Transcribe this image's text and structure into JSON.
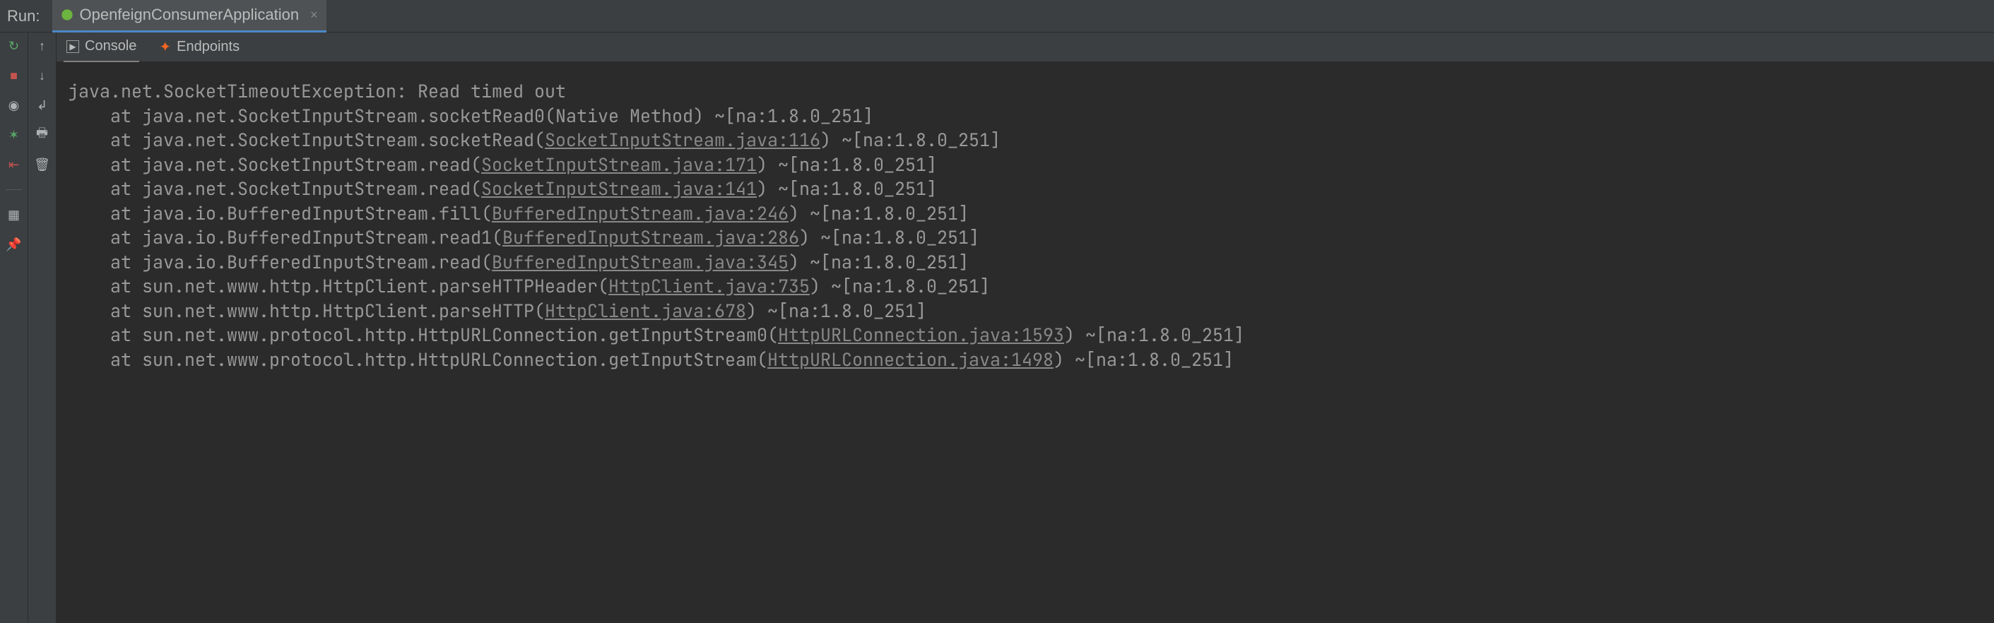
{
  "header": {
    "run_label": "Run:",
    "run_config_name": "OpenfeignConsumerApplication",
    "close_glyph": "×"
  },
  "subtabs": {
    "console": "Console",
    "endpoints": "Endpoints"
  },
  "gutter1_icons": {
    "rerun": "↻",
    "stop": "■",
    "camera": "◉",
    "bug": "✶",
    "exit": "⇤",
    "layout": "▦",
    "pin": "📌"
  },
  "gutter2_icons": {
    "up": "↑",
    "down": "↓",
    "wrap": "↲",
    "print": "🖶",
    "trash": "🗑"
  },
  "console": {
    "head": "java.net.SocketTimeoutException: Read timed out",
    "lines": [
      {
        "prefix": "at java.net.SocketInputStream.socketRead0(Native Method) ~[na:1.8.0_251]",
        "link": "",
        "suffix": ""
      },
      {
        "prefix": "at java.net.SocketInputStream.socketRead(",
        "link": "SocketInputStream.java:116",
        "suffix": ") ~[na:1.8.0_251]"
      },
      {
        "prefix": "at java.net.SocketInputStream.read(",
        "link": "SocketInputStream.java:171",
        "suffix": ") ~[na:1.8.0_251]"
      },
      {
        "prefix": "at java.net.SocketInputStream.read(",
        "link": "SocketInputStream.java:141",
        "suffix": ") ~[na:1.8.0_251]"
      },
      {
        "prefix": "at java.io.BufferedInputStream.fill(",
        "link": "BufferedInputStream.java:246",
        "suffix": ") ~[na:1.8.0_251]"
      },
      {
        "prefix": "at java.io.BufferedInputStream.read1(",
        "link": "BufferedInputStream.java:286",
        "suffix": ") ~[na:1.8.0_251]"
      },
      {
        "prefix": "at java.io.BufferedInputStream.read(",
        "link": "BufferedInputStream.java:345",
        "suffix": ") ~[na:1.8.0_251]"
      },
      {
        "prefix": "at sun.net.www.http.HttpClient.parseHTTPHeader(",
        "link": "HttpClient.java:735",
        "suffix": ") ~[na:1.8.0_251]"
      },
      {
        "prefix": "at sun.net.www.http.HttpClient.parseHTTP(",
        "link": "HttpClient.java:678",
        "suffix": ") ~[na:1.8.0_251]"
      },
      {
        "prefix": "at sun.net.www.protocol.http.HttpURLConnection.getInputStream0(",
        "link": "HttpURLConnection.java:1593",
        "suffix": ") ~[na:1.8.0_251]"
      },
      {
        "prefix": "at sun.net.www.protocol.http.HttpURLConnection.getInputStream(",
        "link": "HttpURLConnection.java:1498",
        "suffix": ") ~[na:1.8.0_251]"
      }
    ]
  }
}
